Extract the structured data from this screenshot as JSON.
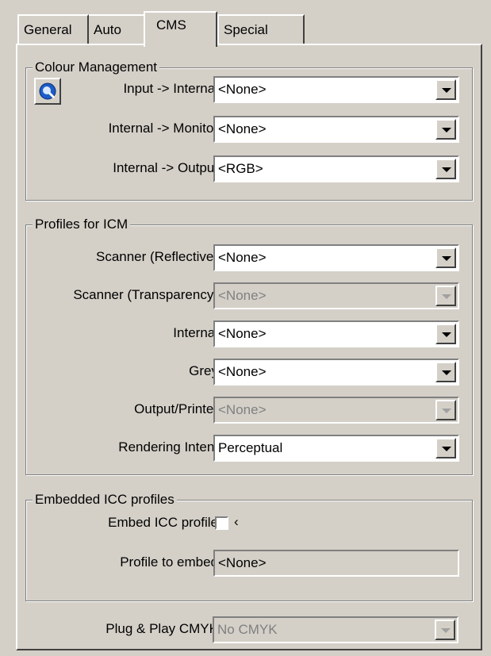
{
  "tabs": [
    {
      "label": "General"
    },
    {
      "label": "Auto"
    },
    {
      "label": "CMS",
      "active": true
    },
    {
      "label": "Special"
    }
  ],
  "colour_management": {
    "title": "Colour Management",
    "rows": [
      {
        "label": "Input -> Internal",
        "value": "<None>"
      },
      {
        "label": "Internal -> Monitor",
        "value": "<None>"
      },
      {
        "label": "Internal -> Output",
        "value": "<RGB>"
      }
    ]
  },
  "profiles": {
    "title": "Profiles for ICM",
    "rows": [
      {
        "label": "Scanner (Reflective)",
        "value": "<None>",
        "enabled": true
      },
      {
        "label": "Scanner (Transparency)",
        "value": "<None>",
        "enabled": false
      },
      {
        "label": "Internal",
        "value": "<None>",
        "enabled": true
      },
      {
        "label": "Grey",
        "value": "<None>",
        "enabled": true
      },
      {
        "label": "Output/Printer",
        "value": "<None>",
        "enabled": false
      },
      {
        "label": "Rendering Intent",
        "value": "Perceptual",
        "enabled": true
      }
    ]
  },
  "embedded": {
    "title": "Embedded ICC profiles",
    "embed_label": "Embed ICC profile",
    "embed_checked": false,
    "embed_suffix": "‹",
    "profile_label": "Profile to embed",
    "profile_value": "<None>"
  },
  "plug_play": {
    "label": "Plug & Play CMYK",
    "value": "No CMYK"
  },
  "colors": {
    "face": "#d4d0c8",
    "accent": "#1c5cc8"
  }
}
